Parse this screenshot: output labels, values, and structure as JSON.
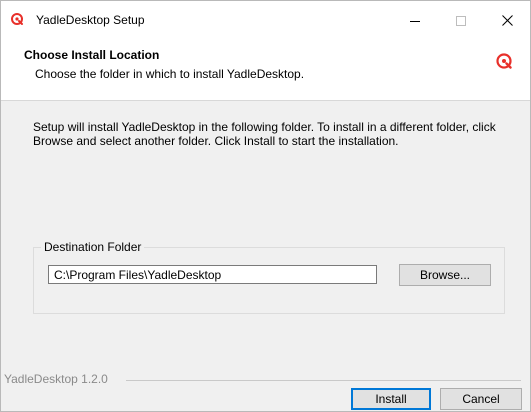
{
  "window": {
    "title": "YadleDesktop Setup",
    "controls": {
      "minimize": "minimize",
      "maximize": "maximize",
      "close": "close"
    }
  },
  "header": {
    "title": "Choose Install Location",
    "subtitle": "Choose the folder in which to install YadleDesktop.",
    "logo_icon": "yadle-logo-icon",
    "brand_color": "#e8302a"
  },
  "body": {
    "intro": "Setup will install YadleDesktop in the following folder. To install in a different folder, click Browse and select another folder. Click Install to start the installation.",
    "destination": {
      "legend": "Destination Folder",
      "path": "C:\\Program Files\\YadleDesktop",
      "browse_label": "Browse..."
    },
    "branding": "YadleDesktop 1.2.0"
  },
  "footer": {
    "install_label": "Install",
    "cancel_label": "Cancel"
  }
}
